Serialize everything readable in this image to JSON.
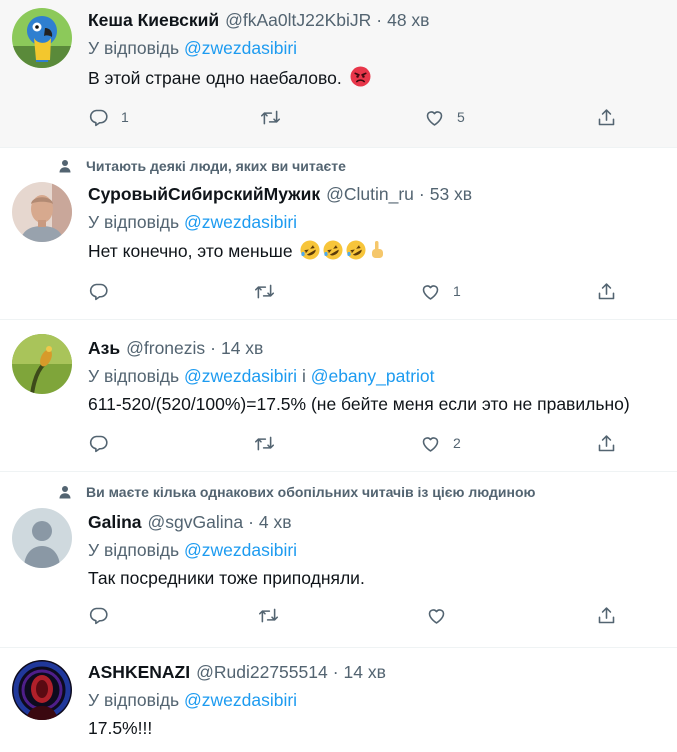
{
  "tweets": [
    {
      "name": "Кеша Киевский",
      "handle": "@fkAa0ltJ22KbiJR",
      "time": "48 хв",
      "reply_prefix": "У відповідь",
      "reply_to": "@zwezdasibiri",
      "text": "В этой стране одно наебалово.",
      "emoji": "angry-face-icon",
      "counts": {
        "reply": "1",
        "retweet": "",
        "like": "5"
      }
    },
    {
      "social_context": "Читають деякі люди, яких ви читаєте",
      "name": "СуровыйСибирскийМужик",
      "handle": "@Clutin_ru",
      "time": "53 хв",
      "reply_prefix": "У відповідь",
      "reply_to": "@zwezdasibiri",
      "text": "Нет конечно, это меньше",
      "emoji": "rofl-face-icons-and-pointing-up-hand",
      "counts": {
        "reply": "",
        "retweet": "",
        "like": "1"
      }
    },
    {
      "name": "Азь",
      "handle": "@fronezis",
      "time": "14 хв",
      "reply_prefix": "У відповідь",
      "reply_to": "@zwezdasibiri",
      "reply_joiner": "і",
      "reply_to_2": "@ebany_patriot",
      "text": "611-520/(520/100%)=17.5% (не бейте меня если это не правильно)",
      "counts": {
        "reply": "",
        "retweet": "",
        "like": "2"
      }
    },
    {
      "social_context": "Ви маєте кілька однакових обопільних читачів із цією людиною",
      "name": "Galina",
      "handle": "@sgvGalina",
      "time": "4 хв",
      "reply_prefix": "У відповідь",
      "reply_to": "@zwezdasibiri",
      "text": "Так посредники тоже приподняли.",
      "counts": {
        "reply": "",
        "retweet": "",
        "like": ""
      }
    },
    {
      "name": "ASHKENAZI",
      "handle": "@Rudi22755514",
      "time": "14 хв",
      "reply_prefix": "У відповідь",
      "reply_to": "@zwezdasibiri",
      "text": "17.5%!!!"
    }
  ],
  "separator": "·",
  "icons": {
    "reply": "reply-icon",
    "retweet": "retweet-icon",
    "like": "heart-icon",
    "share": "share-icon",
    "social": "person-icon"
  },
  "colors": {
    "link": "#1d9bf0",
    "secondary_text": "#536471",
    "highlight_bg": "#f7f7f7"
  }
}
